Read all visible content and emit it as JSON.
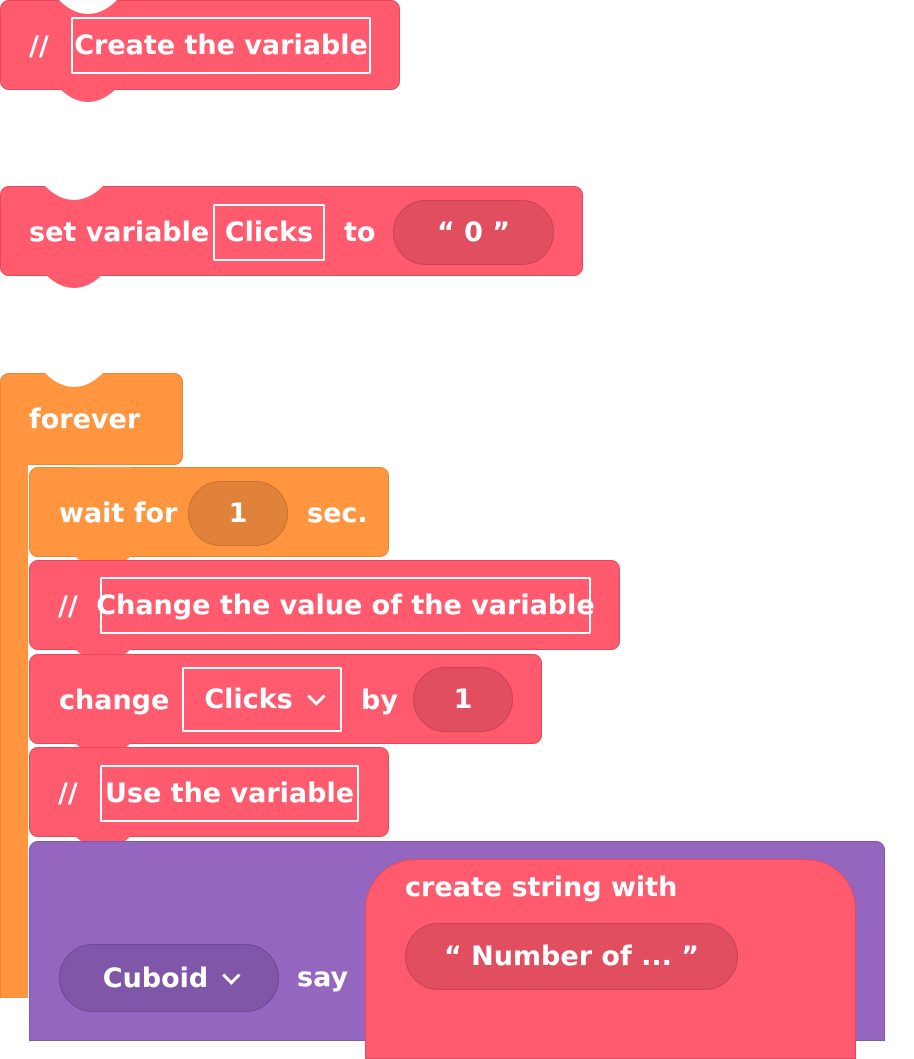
{
  "blocks": {
    "comment1": {
      "prefix": "//",
      "text": "Create the variable"
    },
    "set_variable": {
      "label": "set variable",
      "variable": "Clicks",
      "to_label": "to",
      "value": "“  0  ”"
    },
    "forever": {
      "label": "forever"
    },
    "wait": {
      "label": "wait for",
      "value": "1",
      "unit": "sec."
    },
    "comment2": {
      "prefix": "//",
      "text": "Change the value of the variable"
    },
    "change": {
      "label": "change",
      "variable": "Clicks",
      "by_label": "by",
      "value": "1"
    },
    "comment3": {
      "prefix": "//",
      "text": "Use the variable"
    },
    "say": {
      "sprite": "Cuboid",
      "label": "say",
      "create_string_label": "create string with",
      "string_value": "“  Number of ...  ”"
    }
  },
  "colors": {
    "variables": "#ff5a6e",
    "control": "#ff953f",
    "looks": "#9566bf"
  }
}
